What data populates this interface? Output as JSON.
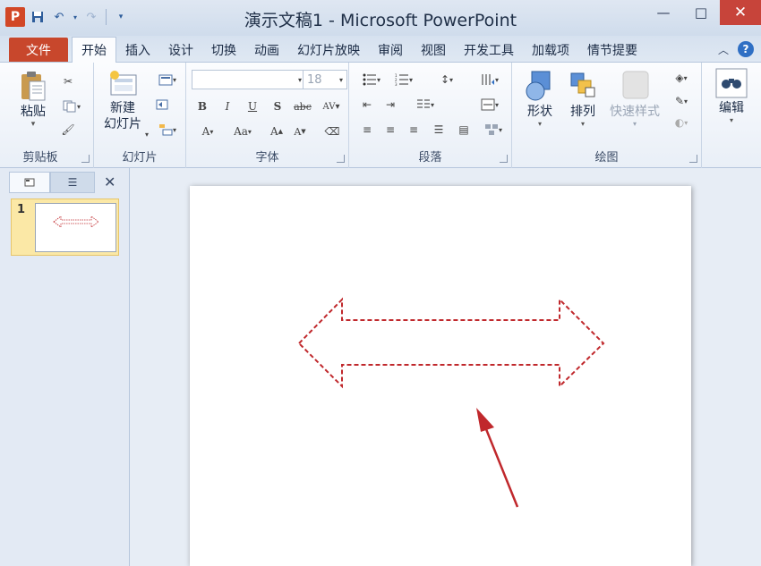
{
  "window": {
    "title": "演示文稿1 - Microsoft PowerPoint",
    "app_logo_letter": "P",
    "minimize_symbol": "—",
    "maximize_symbol": "□",
    "close_symbol": "✕"
  },
  "tabs": [
    {
      "label": "文件",
      "kind": "file"
    },
    {
      "label": "开始",
      "kind": "active"
    },
    {
      "label": "插入"
    },
    {
      "label": "设计"
    },
    {
      "label": "切换"
    },
    {
      "label": "动画"
    },
    {
      "label": "幻灯片放映"
    },
    {
      "label": "审阅"
    },
    {
      "label": "视图"
    },
    {
      "label": "开发工具"
    },
    {
      "label": "加载项"
    },
    {
      "label": "情节提要"
    }
  ],
  "ribbon": {
    "clipboard": {
      "group_label": "剪贴板",
      "paste_label": "粘贴"
    },
    "slides": {
      "group_label": "幻灯片",
      "new_slide_label_1": "新建",
      "new_slide_label_2": "幻灯片"
    },
    "font": {
      "group_label": "字体",
      "font_name": "",
      "font_size": "18"
    },
    "paragraph": {
      "group_label": "段落"
    },
    "drawing": {
      "group_label": "绘图",
      "shapes_label": "形状",
      "arrange_label": "排列",
      "quick_styles_label": "快速样式"
    },
    "editing": {
      "edit_label": "编辑"
    }
  },
  "slides_panel": {
    "slide_number": "1"
  },
  "slide": {
    "shape": "left-right-arrow",
    "shape_outline_color": "#c0282c",
    "shape_outline_style": "dashed",
    "pointer_arrow_color": "#c0282c"
  },
  "colors": {
    "file_tab": "#c8472c",
    "accent": "#2f6fc4",
    "thumbnail_highlight": "#fbe8a6"
  }
}
